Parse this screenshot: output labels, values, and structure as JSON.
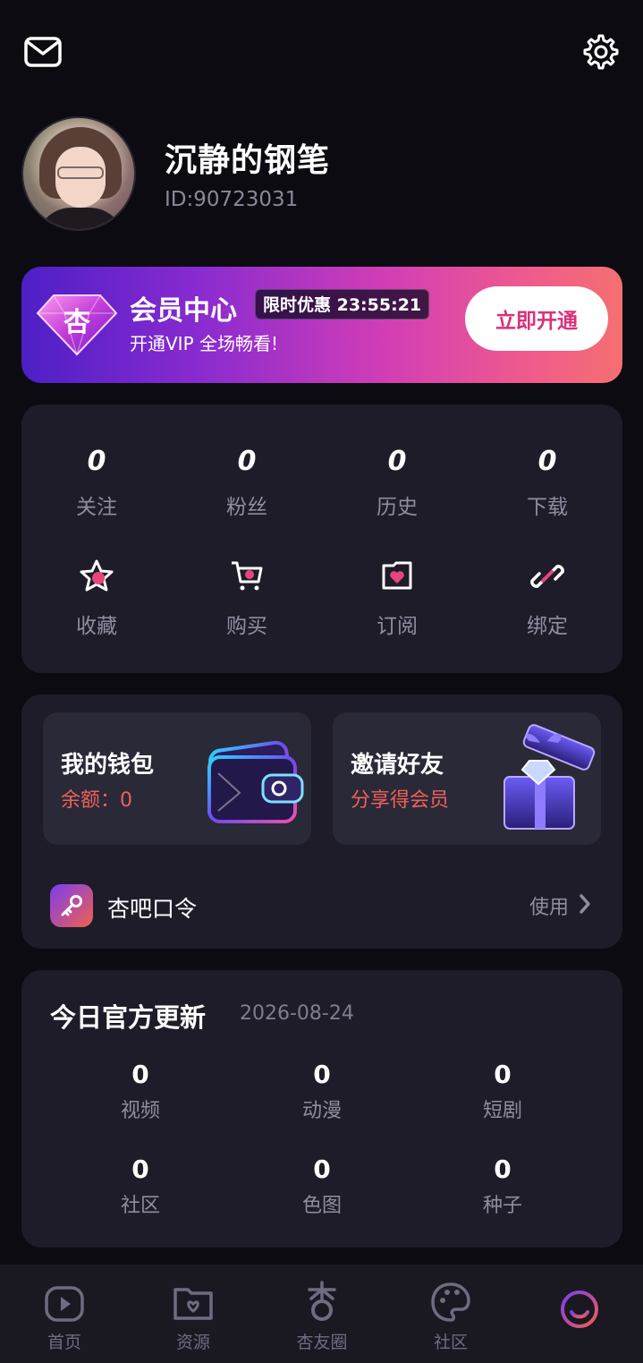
{
  "header": {
    "mail_icon": "mail-icon",
    "settings_icon": "gear-icon"
  },
  "profile": {
    "name": "沉静的钢笔",
    "id_text": "ID:90723031"
  },
  "vip": {
    "gem_char": "杏",
    "title": "会员中心",
    "badge": "限时优惠 23:55:21",
    "subtitle": "开通VIP 全场畅看!",
    "button": "立即开通"
  },
  "stats": [
    {
      "value": "0",
      "label": "关注"
    },
    {
      "value": "0",
      "label": "粉丝"
    },
    {
      "value": "0",
      "label": "历史"
    },
    {
      "value": "0",
      "label": "下载"
    }
  ],
  "tools": [
    {
      "label": "收藏",
      "icon": "star-icon"
    },
    {
      "label": "购买",
      "icon": "cart-icon"
    },
    {
      "label": "订阅",
      "icon": "subscribe-heart-icon"
    },
    {
      "label": "绑定",
      "icon": "link-icon"
    }
  ],
  "wallet": {
    "title": "我的钱包",
    "balance": "余额：0"
  },
  "invite": {
    "title": "邀请好友",
    "subtitle": "分享得会员"
  },
  "passcode": {
    "label": "杏吧口令",
    "action": "使用"
  },
  "updates": {
    "title": "今日官方更新",
    "date": "2026-08-24",
    "items": [
      {
        "value": "0",
        "label": "视频"
      },
      {
        "value": "0",
        "label": "动漫"
      },
      {
        "value": "0",
        "label": "短剧"
      },
      {
        "value": "0",
        "label": "社区"
      },
      {
        "value": "0",
        "label": "色图"
      },
      {
        "value": "0",
        "label": "种子"
      }
    ]
  },
  "nav": [
    {
      "label": "首页",
      "icon": "play-home-icon"
    },
    {
      "label": "资源",
      "icon": "resource-folder-icon"
    },
    {
      "label": "杏友圈",
      "icon": "apricot-circle-icon"
    },
    {
      "label": "社区",
      "icon": "palette-icon"
    },
    {
      "label": "",
      "icon": "profile-smile-icon",
      "active": true
    }
  ],
  "colors": {
    "background": "#0c0b12",
    "card": "#1d1c28",
    "accent_red": "#f0605a",
    "vip_pink": "#d9307a"
  }
}
